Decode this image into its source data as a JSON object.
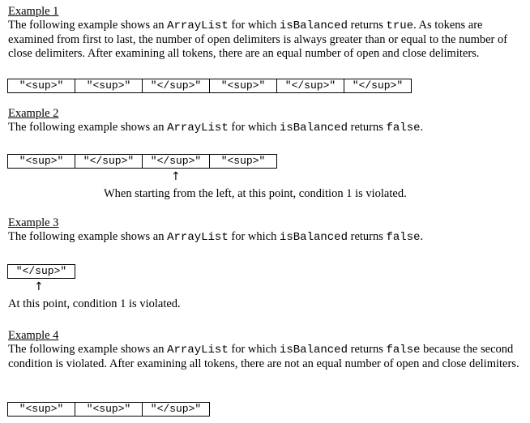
{
  "ex1": {
    "heading": "Example 1",
    "t1": "The following example shows an ",
    "code1": "ArrayList",
    "t2": " for which ",
    "code2": "isBalanced",
    "t3": " returns ",
    "code3": "true",
    "t4": ". As tokens are examined from first to last, the number of open delimiters is always greater than or equal to the number of close delimiters. After examining all tokens, there are an equal number of open and close delimiters.",
    "tokens": [
      "\"<sup>\"",
      "\"<sup>\"",
      "\"</sup>\"",
      "\"<sup>\"",
      "\"</sup>\"",
      "\"</sup>\""
    ]
  },
  "ex2": {
    "heading": "Example 2",
    "t1": "The following example shows an ",
    "code1": "ArrayList",
    "t2": " for which ",
    "code2": "isBalanced",
    "t3": " returns ",
    "code3": "false",
    "t4": ".",
    "tokens": [
      "\"<sup>\"",
      "\"</sup>\"",
      "\"</sup>\"",
      "\"<sup>\""
    ],
    "arrow": "↑",
    "note": "When starting from the left, at this point, condition 1 is violated."
  },
  "ex3": {
    "heading": "Example 3",
    "t1": "The following example shows an ",
    "code1": "ArrayList",
    "t2": " for which ",
    "code2": "isBalanced",
    "t3": " returns ",
    "code3": "false",
    "t4": ".",
    "tokens": [
      "\"</sup>\""
    ],
    "arrow": "↑",
    "note": "At this point, condition 1 is violated."
  },
  "ex4": {
    "heading": "Example 4",
    "t1": "The following example shows an ",
    "code1": "ArrayList",
    "t2": " for which ",
    "code2": "isBalanced",
    "t3": " returns ",
    "code3": "false",
    "t4": " because the second condition is violated. After examining all tokens, there are not an equal number of open and close delimiters.",
    "tokens": [
      "\"<sup>\"",
      "\"<sup>\"",
      "\"</sup>\""
    ]
  }
}
